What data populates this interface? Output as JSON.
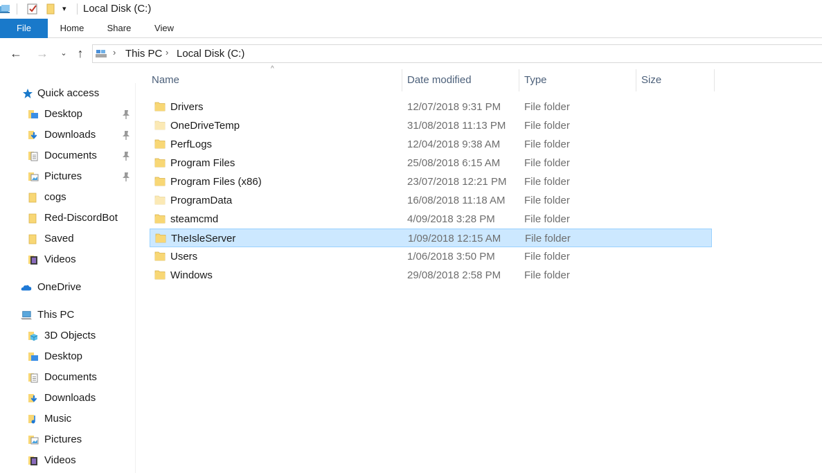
{
  "window": {
    "title": "Local Disk (C:)"
  },
  "ribbon": {
    "tabs": [
      "File",
      "Home",
      "Share",
      "View"
    ]
  },
  "address": {
    "crumbs": [
      "This PC",
      "Local Disk (C:)"
    ]
  },
  "columns": [
    "Name",
    "Date modified",
    "Type",
    "Size"
  ],
  "files": [
    {
      "name": "Drivers",
      "date": "12/07/2018 9:31 PM",
      "type": "File folder",
      "faded": false
    },
    {
      "name": "OneDriveTemp",
      "date": "31/08/2018 11:13 PM",
      "type": "File folder",
      "faded": true
    },
    {
      "name": "PerfLogs",
      "date": "12/04/2018 9:38 AM",
      "type": "File folder",
      "faded": false
    },
    {
      "name": "Program Files",
      "date": "25/08/2018 6:15 AM",
      "type": "File folder",
      "faded": false
    },
    {
      "name": "Program Files (x86)",
      "date": "23/07/2018 12:21 PM",
      "type": "File folder",
      "faded": false
    },
    {
      "name": "ProgramData",
      "date": "16/08/2018 11:18 AM",
      "type": "File folder",
      "faded": true
    },
    {
      "name": "steamcmd",
      "date": "4/09/2018 3:28 PM",
      "type": "File folder",
      "faded": false
    },
    {
      "name": "TheIsleServer",
      "date": "1/09/2018 12:15 AM",
      "type": "File folder",
      "faded": false,
      "selected": true
    },
    {
      "name": "Users",
      "date": "1/06/2018 3:50 PM",
      "type": "File folder",
      "faded": false
    },
    {
      "name": "Windows",
      "date": "29/08/2018 2:58 PM",
      "type": "File folder",
      "faded": false
    }
  ],
  "sidebar": {
    "quick_access": "Quick access",
    "quick_items": [
      {
        "label": "Desktop",
        "icon": "desktop-icon",
        "pinned": true
      },
      {
        "label": "Downloads",
        "icon": "downloads-icon",
        "pinned": true
      },
      {
        "label": "Documents",
        "icon": "documents-icon",
        "pinned": true
      },
      {
        "label": "Pictures",
        "icon": "pictures-icon",
        "pinned": true
      },
      {
        "label": "cogs",
        "icon": "folder-icon",
        "pinned": false
      },
      {
        "label": "Red-DiscordBot",
        "icon": "folder-icon",
        "pinned": false
      },
      {
        "label": "Saved",
        "icon": "folder-icon",
        "pinned": false
      },
      {
        "label": "Videos",
        "icon": "videos-icon",
        "pinned": false
      }
    ],
    "onedrive": "OneDrive",
    "this_pc": "This PC",
    "pc_items": [
      {
        "label": "3D Objects",
        "icon": "3d-objects-icon"
      },
      {
        "label": "Desktop",
        "icon": "desktop-icon"
      },
      {
        "label": "Documents",
        "icon": "documents-icon"
      },
      {
        "label": "Downloads",
        "icon": "downloads-icon"
      },
      {
        "label": "Music",
        "icon": "music-icon"
      },
      {
        "label": "Pictures",
        "icon": "pictures-icon"
      },
      {
        "label": "Videos",
        "icon": "videos-icon"
      }
    ]
  },
  "colors": {
    "accent": "#1979ca",
    "selection": "#cce8ff",
    "selection_border": "#99d1ff",
    "folder": "#f8d775"
  }
}
